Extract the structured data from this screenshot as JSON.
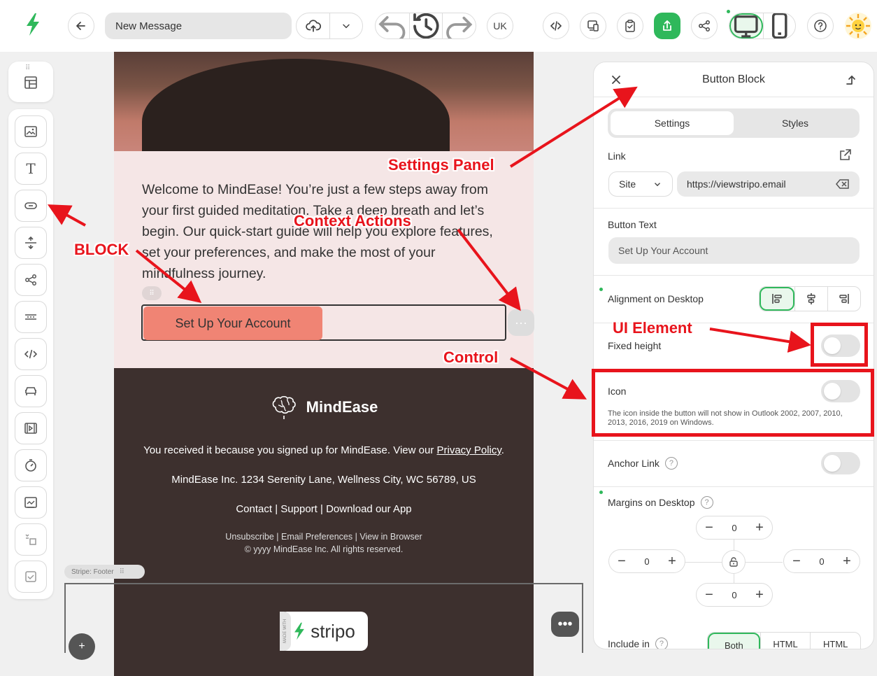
{
  "topbar": {
    "message_name": "New Message",
    "language": "UK"
  },
  "email": {
    "welcome_text": "Welcome to MindEase! You’re just a few steps away from your first guided meditation. Take a deep breath and let’s begin. Our quick-start guide will help you explore features, set your preferences, and make the most of your mindfulness journey.",
    "cta_label": "Set Up Your Account",
    "footer": {
      "brand": "MindEase",
      "received_text": "You received it because you signed up for MindEase.  View our ",
      "privacy_link": "Privacy Policy",
      "privacy_suffix": ".",
      "address": "MindEase Inc. 1234 Serenity Lane, Wellness City, WC 56789, US",
      "links": [
        "Contact",
        "Support",
        "Download our App"
      ],
      "sub_links": [
        "Unsubscribe",
        "Email Preferences",
        "View in Browser"
      ],
      "copyright": "© yyyy MindEase Inc. All rights reserved."
    },
    "stripe_label": "Stripe: Footer",
    "badge_text": "stripo",
    "badge_side_text": "MADE WITH"
  },
  "panel": {
    "title": "Button Block",
    "tabs": [
      "Settings",
      "Styles"
    ],
    "link_label": "Link",
    "link_type": "Site",
    "link_url": "https://viewstripo.email",
    "button_text_label": "Button Text",
    "button_text_value": "Set Up Your Account",
    "alignment_label": "Alignment on Desktop",
    "fixed_height_label": "Fixed height",
    "icon_label": "Icon",
    "icon_note": "The icon inside the button will not show in Outlook 2002, 2007, 2010, 2013, 2016, 2019 on Windows.",
    "anchor_label": "Anchor Link",
    "margins_label": "Margins on Desktop",
    "margin_top": "0",
    "margin_left": "0",
    "margin_right": "0",
    "margin_bottom": "0",
    "include_label": "Include in",
    "include_options": [
      "Both",
      "HTML",
      "HTML"
    ]
  },
  "annotations": {
    "settings_panel": "Settings Panel",
    "context_actions": "Context Actions",
    "block": "BLOCK",
    "ui_element": "UI Element",
    "control": "Control"
  },
  "colors": {
    "brand_green": "#2fb85b",
    "cta": "#f08474",
    "annotation_red": "#e8141c",
    "footer_bg": "#3d302e"
  }
}
